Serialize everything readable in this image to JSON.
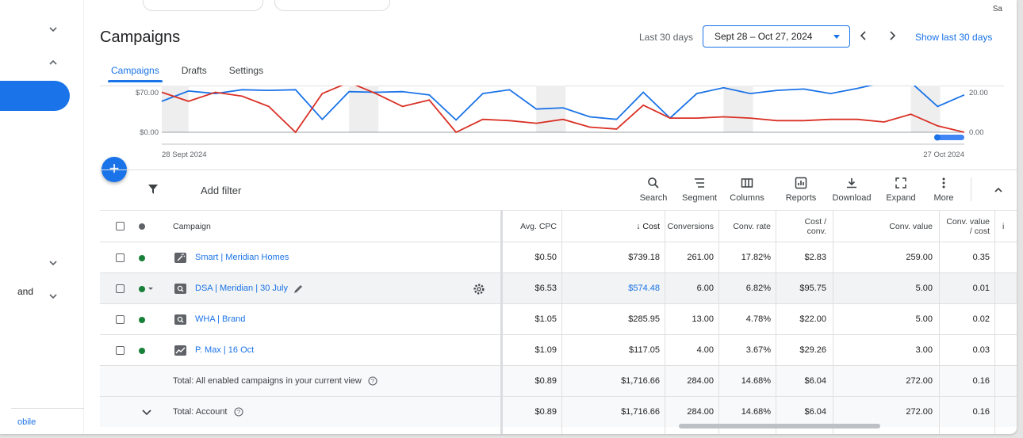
{
  "header": {
    "title": "Campaigns",
    "date_label": "Last 30 days",
    "date_range": "Sept 28 – Oct 27, 2024",
    "show_last": "Show last 30 days",
    "corner_text": "Sa"
  },
  "tabs": [
    {
      "label": "Campaigns",
      "active": true
    },
    {
      "label": "Drafts",
      "active": false
    },
    {
      "label": "Settings",
      "active": false
    }
  ],
  "sidebar": {
    "partial_label": "and",
    "bottom_link": "obile"
  },
  "chart_data": {
    "type": "line",
    "x_start_label": "28 Sept 2024",
    "x_end_label": "27 Oct 2024",
    "left_axis_ticks": [
      "$70.00",
      "$0.00"
    ],
    "right_axis_ticks": [
      "20.00",
      "0.00"
    ],
    "series": [
      {
        "color": "#1a73e8",
        "values": [
          48,
          64,
          60,
          66,
          65,
          66,
          20,
          63,
          62,
          63,
          58,
          19,
          60,
          66,
          36,
          38,
          24,
          20,
          62,
          22,
          60,
          69,
          60,
          65,
          67,
          60,
          68,
          80,
          78,
          40,
          58
        ]
      },
      {
        "color": "#d93025",
        "values": [
          62,
          48,
          62,
          56,
          40,
          0,
          60,
          80,
          60,
          40,
          50,
          0,
          20,
          18,
          14,
          20,
          8,
          5,
          42,
          22,
          22,
          24,
          22,
          18,
          18,
          20,
          20,
          16,
          28,
          10,
          0
        ]
      }
    ],
    "ylim": [
      0,
      70
    ]
  },
  "toolbar": {
    "add_filter": "Add filter",
    "tools": [
      {
        "label": "Search",
        "icon": "search-icon"
      },
      {
        "label": "Segment",
        "icon": "segment-icon"
      },
      {
        "label": "Columns",
        "icon": "columns-icon"
      },
      {
        "label": "Reports",
        "icon": "reports-icon"
      },
      {
        "label": "Download",
        "icon": "download-icon"
      },
      {
        "label": "Expand",
        "icon": "expand-icon"
      },
      {
        "label": "More",
        "icon": "more-icon"
      }
    ]
  },
  "table": {
    "headers": {
      "campaign": "Campaign",
      "avg_cpc": "Avg. CPC",
      "cost": "↓ Cost",
      "conversions": "Conversions",
      "conv_rate": "Conv. rate",
      "cost_conv_1": "Cost /",
      "cost_conv_2": "conv.",
      "conv_value": "Conv. value",
      "cvc_1": "Conv. value",
      "cvc_2": "/ cost",
      "overflow": "i"
    },
    "rows": [
      {
        "name": "Smart | Meridian Homes",
        "type_icon": "smart-campaign-icon",
        "status_color": "#188038",
        "avg_cpc": "$0.50",
        "cost": "$739.18",
        "conversions": "261.00",
        "conv_rate": "17.82%",
        "cost_conv": "$2.83",
        "conv_value": "259.00",
        "cvc": "0.35"
      },
      {
        "name": "DSA | Meridian | 30 July",
        "type_icon": "search-campaign-icon",
        "status_color": "#188038",
        "avg_cpc": "$6.53",
        "cost": "$574.48",
        "conversions": "6.00",
        "conv_rate": "6.82%",
        "cost_conv": "$95.75",
        "conv_value": "5.00",
        "cvc": "0.01"
      },
      {
        "name": "WHA | Brand",
        "type_icon": "search-campaign-icon",
        "status_color": "#188038",
        "avg_cpc": "$1.05",
        "cost": "$285.95",
        "conversions": "13.00",
        "conv_rate": "4.78%",
        "cost_conv": "$22.00",
        "conv_value": "5.00",
        "cvc": "0.02"
      },
      {
        "name": "P. Max | 16 Oct",
        "type_icon": "pmax-campaign-icon",
        "status_color": "#188038",
        "avg_cpc": "$1.09",
        "cost": "$117.05",
        "conversions": "4.00",
        "conv_rate": "3.67%",
        "cost_conv": "$29.26",
        "conv_value": "3.00",
        "cvc": "0.03"
      }
    ],
    "totals": [
      {
        "label": "Total: All enabled campaigns in your current view",
        "avg_cpc": "$0.89",
        "cost": "$1,716.66",
        "conversions": "284.00",
        "conv_rate": "14.68%",
        "cost_conv": "$6.04",
        "conv_value": "272.00",
        "cvc": "0.16"
      },
      {
        "label": "Total: Account",
        "avg_cpc": "$0.89",
        "cost": "$1,716.66",
        "conversions": "284.00",
        "conv_rate": "14.68%",
        "cost_conv": "$6.04",
        "conv_value": "272.00",
        "cvc": "0.16"
      }
    ]
  }
}
